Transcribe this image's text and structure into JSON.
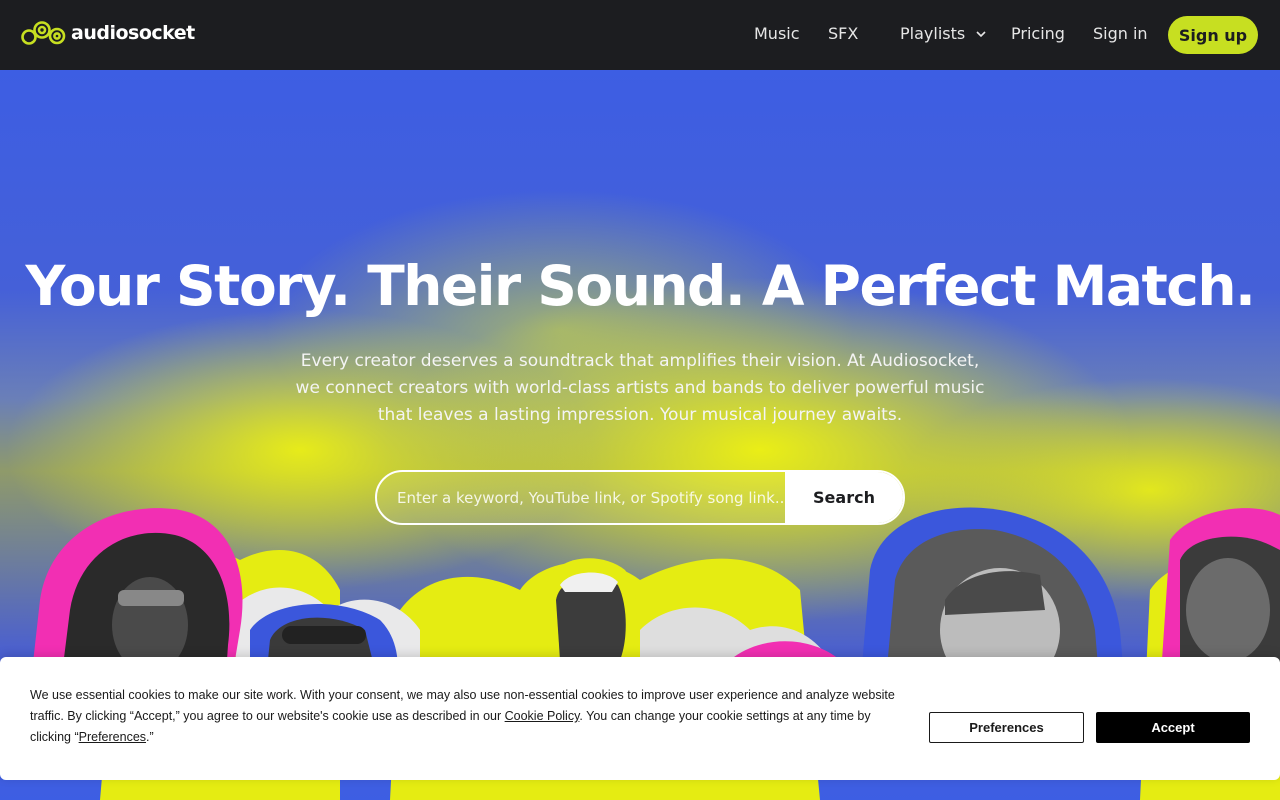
{
  "brand": {
    "name": "audiosocket",
    "accent": "#c7df21",
    "nav_bg": "#1c1d20"
  },
  "nav": {
    "music": "Music",
    "sfx": "SFX",
    "playlists": "Playlists",
    "pricing": "Pricing",
    "signin": "Sign in",
    "signup": "Sign up",
    "playlists_icon": "chevron-down-icon"
  },
  "hero": {
    "title": "Your Story. Their Sound. A Perfect Match.",
    "subtitle": "Every creator deserves a soundtrack that amplifies their vision. At Audiosocket, we connect creators with world-class artists and bands to deliver powerful music that leaves a lasting impression. Your musical journey awaits.",
    "search": {
      "placeholder": "Enter a keyword, YouTube link, or Spotify song link...",
      "button": "Search"
    },
    "colors": {
      "blue": "#3d5ee3",
      "yellow": "#ecf014",
      "pink": "#f22fb3"
    }
  },
  "cookie": {
    "text_before_policy": "We use essential cookies to make our site work. With your consent, we may also use non-essential cookies to improve user experience and analyze website traffic. By clicking “Accept,” you agree to our website's cookie use as described in our ",
    "policy_link": "Cookie Policy",
    "text_after_policy": ". You can change your cookie settings at any time by clicking “",
    "preferences_link": "Preferences",
    "text_end": ".”",
    "preferences_button": "Preferences",
    "accept_button": "Accept"
  }
}
